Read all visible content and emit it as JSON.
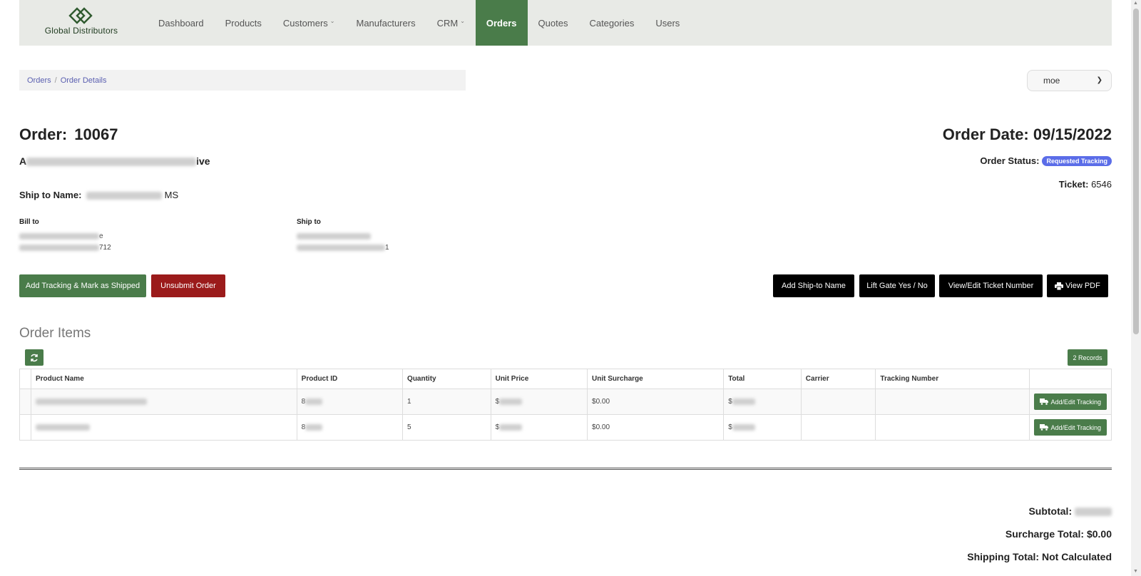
{
  "brand": {
    "name": "Global Distributors",
    "logo_icon": "diamond-logo"
  },
  "nav": [
    {
      "label": "Dashboard",
      "caret": false,
      "active": false
    },
    {
      "label": "Products",
      "caret": false,
      "active": false
    },
    {
      "label": "Customers",
      "caret": true,
      "active": false
    },
    {
      "label": "Manufacturers",
      "caret": false,
      "active": false
    },
    {
      "label": "CRM",
      "caret": true,
      "active": false
    },
    {
      "label": "Orders",
      "caret": false,
      "active": true
    },
    {
      "label": "Quotes",
      "caret": false,
      "active": false
    },
    {
      "label": "Categories",
      "caret": false,
      "active": false
    },
    {
      "label": "Users",
      "caret": false,
      "active": false
    }
  ],
  "breadcrumb": {
    "orders": "Orders",
    "details": "Order Details",
    "sep": "/"
  },
  "user_select": {
    "value": "moe"
  },
  "order": {
    "label": "Order:",
    "number": "10067",
    "date_label": "Order Date:",
    "date": "09/15/2022",
    "customer_prefix": "A",
    "customer_suffix": "ive",
    "status_label": "Order Status:",
    "status": "Requested Tracking",
    "ticket_label": "Ticket:",
    "ticket": "6546",
    "ship_to_name_label": "Ship to Name:",
    "ship_to_name_suffix": "MS"
  },
  "addresses": {
    "bill_to_label": "Bill to",
    "bill_line1_suffix": "e",
    "bill_line2_suffix": "712",
    "ship_to_label": "Ship to",
    "ship_line2_suffix": "1"
  },
  "buttons": {
    "add_tracking": "Add Tracking & Mark as Shipped",
    "unsubmit": "Unsubmit Order",
    "add_ship_to_name": "Add Ship-to Name",
    "lift_gate": "Lift Gate Yes / No",
    "view_edit_ticket": "View/Edit Ticket Number",
    "view_pdf": "View PDF"
  },
  "items": {
    "title": "Order Items",
    "records": "2 Records",
    "columns": [
      "Product Name",
      "Product ID",
      "Quantity",
      "Unit Price",
      "Unit Surcharge",
      "Total",
      "Carrier",
      "Tracking Number",
      ""
    ],
    "rows": [
      {
        "product_id_prefix": "8",
        "quantity": "1",
        "unit_price_prefix": "$",
        "surcharge": "$0.00",
        "total_prefix": "$",
        "carrier": "",
        "tracking": "",
        "action": "Add/Edit Tracking"
      },
      {
        "product_id_prefix": "8",
        "quantity": "5",
        "unit_price_prefix": "$",
        "surcharge": "$0.00",
        "total_prefix": "$",
        "carrier": "",
        "tracking": "",
        "action": "Add/Edit Tracking"
      }
    ]
  },
  "totals": {
    "subtotal_label": "Subtotal:",
    "surcharge_label": "Surcharge Total:",
    "surcharge_value": "$0.00",
    "shipping_label": "Shipping Total:",
    "shipping_value": "Not Calculated"
  }
}
